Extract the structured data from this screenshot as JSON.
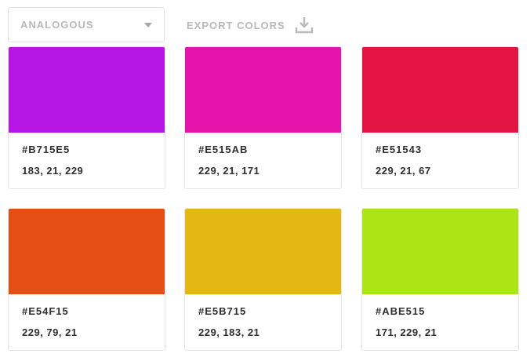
{
  "toolbar": {
    "scheme_label": "ANALOGOUS",
    "export_label": "EXPORT COLORS"
  },
  "colors": [
    {
      "hex": "#B715E5",
      "rgb": "183, 21, 229",
      "swatch": "#B715E5"
    },
    {
      "hex": "#E515AB",
      "rgb": "229, 21, 171",
      "swatch": "#E515AB"
    },
    {
      "hex": "#E51543",
      "rgb": "229, 21, 67",
      "swatch": "#E51543"
    },
    {
      "hex": "#E54F15",
      "rgb": "229, 79, 21",
      "swatch": "#E54F15"
    },
    {
      "hex": "#E5B715",
      "rgb": "229, 183, 21",
      "swatch": "#E5B715"
    },
    {
      "hex": "#ABE515",
      "rgb": "171, 229, 21",
      "swatch": "#ABE515"
    }
  ]
}
